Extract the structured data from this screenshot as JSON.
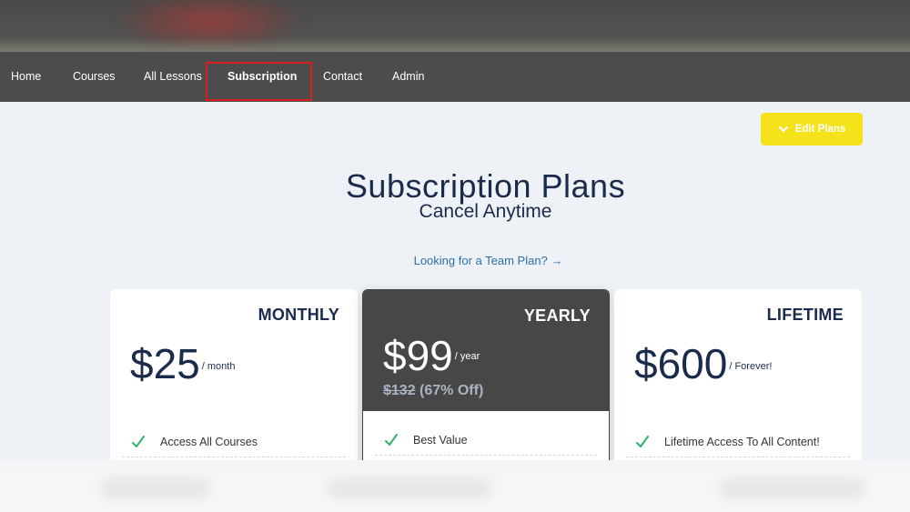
{
  "nav": {
    "items": [
      {
        "label": "Home"
      },
      {
        "label": "Courses"
      },
      {
        "label": "All Lessons"
      },
      {
        "label": "Subscription"
      },
      {
        "label": "Contact"
      },
      {
        "label": "Admin"
      }
    ],
    "active": "Subscription"
  },
  "admin": {
    "edit_plans_label": "Edit Plans",
    "edit_plans_color": "#f4e21a"
  },
  "header": {
    "title": "Subscription Plans",
    "subtitle": "Cancel Anytime",
    "team_link": "Looking for a Team Plan? →"
  },
  "plans": [
    {
      "name": "MONTHLY",
      "price": "$25",
      "period": "/ month",
      "feature": "Access All Courses"
    },
    {
      "name": "YEARLY",
      "price": "$99",
      "period": "/ year",
      "old_price": "$132",
      "discount": "(67% Off)",
      "feature": "Best Value"
    },
    {
      "name": "LIFETIME",
      "price": "$600",
      "period": "/ Forever!",
      "feature": "Lifetime Access To All Content!"
    }
  ],
  "colors": {
    "navbar": "#4c4c4c",
    "heading": "#1a2b4c",
    "link": "#2f6fa8",
    "check": "#2fb36b",
    "highlight_box": "#d61f1f",
    "featured_card": "#474747"
  },
  "icons": {
    "edit_plans": "chevron-down-icon",
    "feature": "checkmark-icon"
  }
}
